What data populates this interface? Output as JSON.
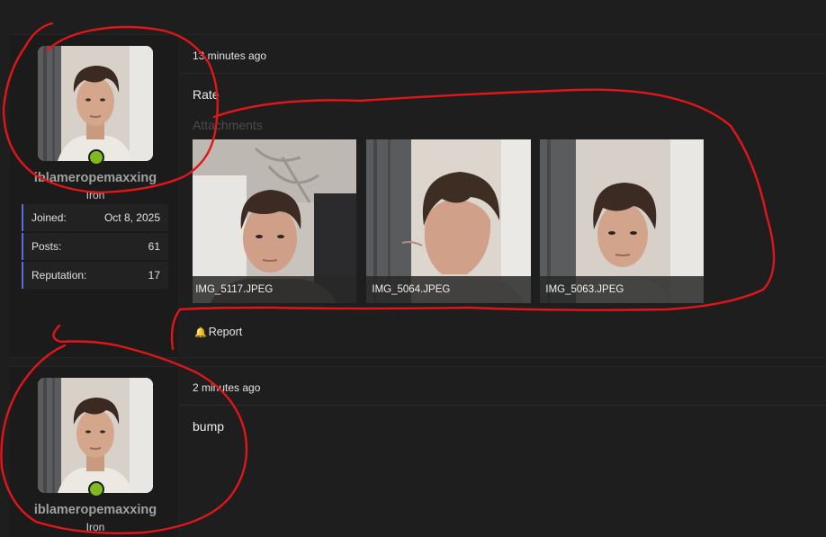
{
  "posts": [
    {
      "user": {
        "name": "iblameropemaxxing",
        "rank": "Iron",
        "online": true
      },
      "stats": [
        {
          "label": "Joined:",
          "value": "Oct 8, 2025"
        },
        {
          "label": "Posts:",
          "value": "61"
        },
        {
          "label": "Reputation:",
          "value": "17"
        }
      ],
      "time": "13 minutes ago",
      "body": "Rate",
      "attachments_label": "Attachments",
      "attachments": [
        {
          "name": "IMG_5117.JPEG"
        },
        {
          "name": "IMG_5064.JPEG"
        },
        {
          "name": "IMG_5063.JPEG"
        }
      ],
      "report_label": "Report"
    },
    {
      "user": {
        "name": "iblameropemaxxing",
        "rank": "Iron",
        "online": true
      },
      "time": "2 minutes ago",
      "body": "bump"
    }
  ],
  "colors": {
    "online": "#7fba1f",
    "stat_accent": "#5a6fd6",
    "annotation": "#e0161b"
  },
  "icons": {
    "report": "bell-icon"
  }
}
